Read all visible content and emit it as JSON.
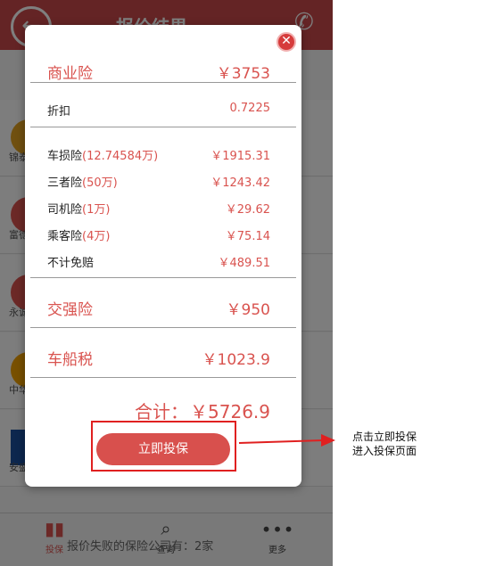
{
  "header": {
    "title": "报价结果"
  },
  "companies": [
    {
      "name": "锦泰",
      "color": "#e0a020"
    },
    {
      "name": "富德",
      "color": "#d9534f"
    },
    {
      "name": "永诚",
      "color": "#d9534f"
    },
    {
      "name": "中华",
      "color": "#f0a000"
    },
    {
      "name": "安盛",
      "color": "#1b4f9c"
    }
  ],
  "tabbar": {
    "quote": "投保",
    "query": "查询",
    "more": "更多",
    "fail_text": "报价失败的保险公司有：2家"
  },
  "modal": {
    "commercial": {
      "label": "商业险",
      "value": "￥3753"
    },
    "discount": {
      "label": "折扣",
      "value": "0.7225"
    },
    "items": [
      {
        "label": "车损险",
        "suffix": "(12.74584万)",
        "value": "￥1915.31"
      },
      {
        "label": "三者险",
        "suffix": "(50万)",
        "value": "￥1243.42"
      },
      {
        "label": "司机险",
        "suffix": "(1万)",
        "value": "￥29.62"
      },
      {
        "label": "乘客险",
        "suffix": "(4万)",
        "value": "￥75.14"
      },
      {
        "label": "不计免赔",
        "suffix": "",
        "value": "￥489.51"
      }
    ],
    "compulsory": {
      "label": "交强险",
      "value": "￥950"
    },
    "vessel_tax": {
      "label": "车船税",
      "value": "￥1023.9"
    },
    "total_label": "合计：",
    "total_value": "￥5726.9",
    "button": "立即投保"
  },
  "annotation": {
    "line1": "点击立即投保",
    "line2": "进入投保页面"
  },
  "colors": {
    "accent": "#d9534f",
    "header": "#c8494a"
  }
}
